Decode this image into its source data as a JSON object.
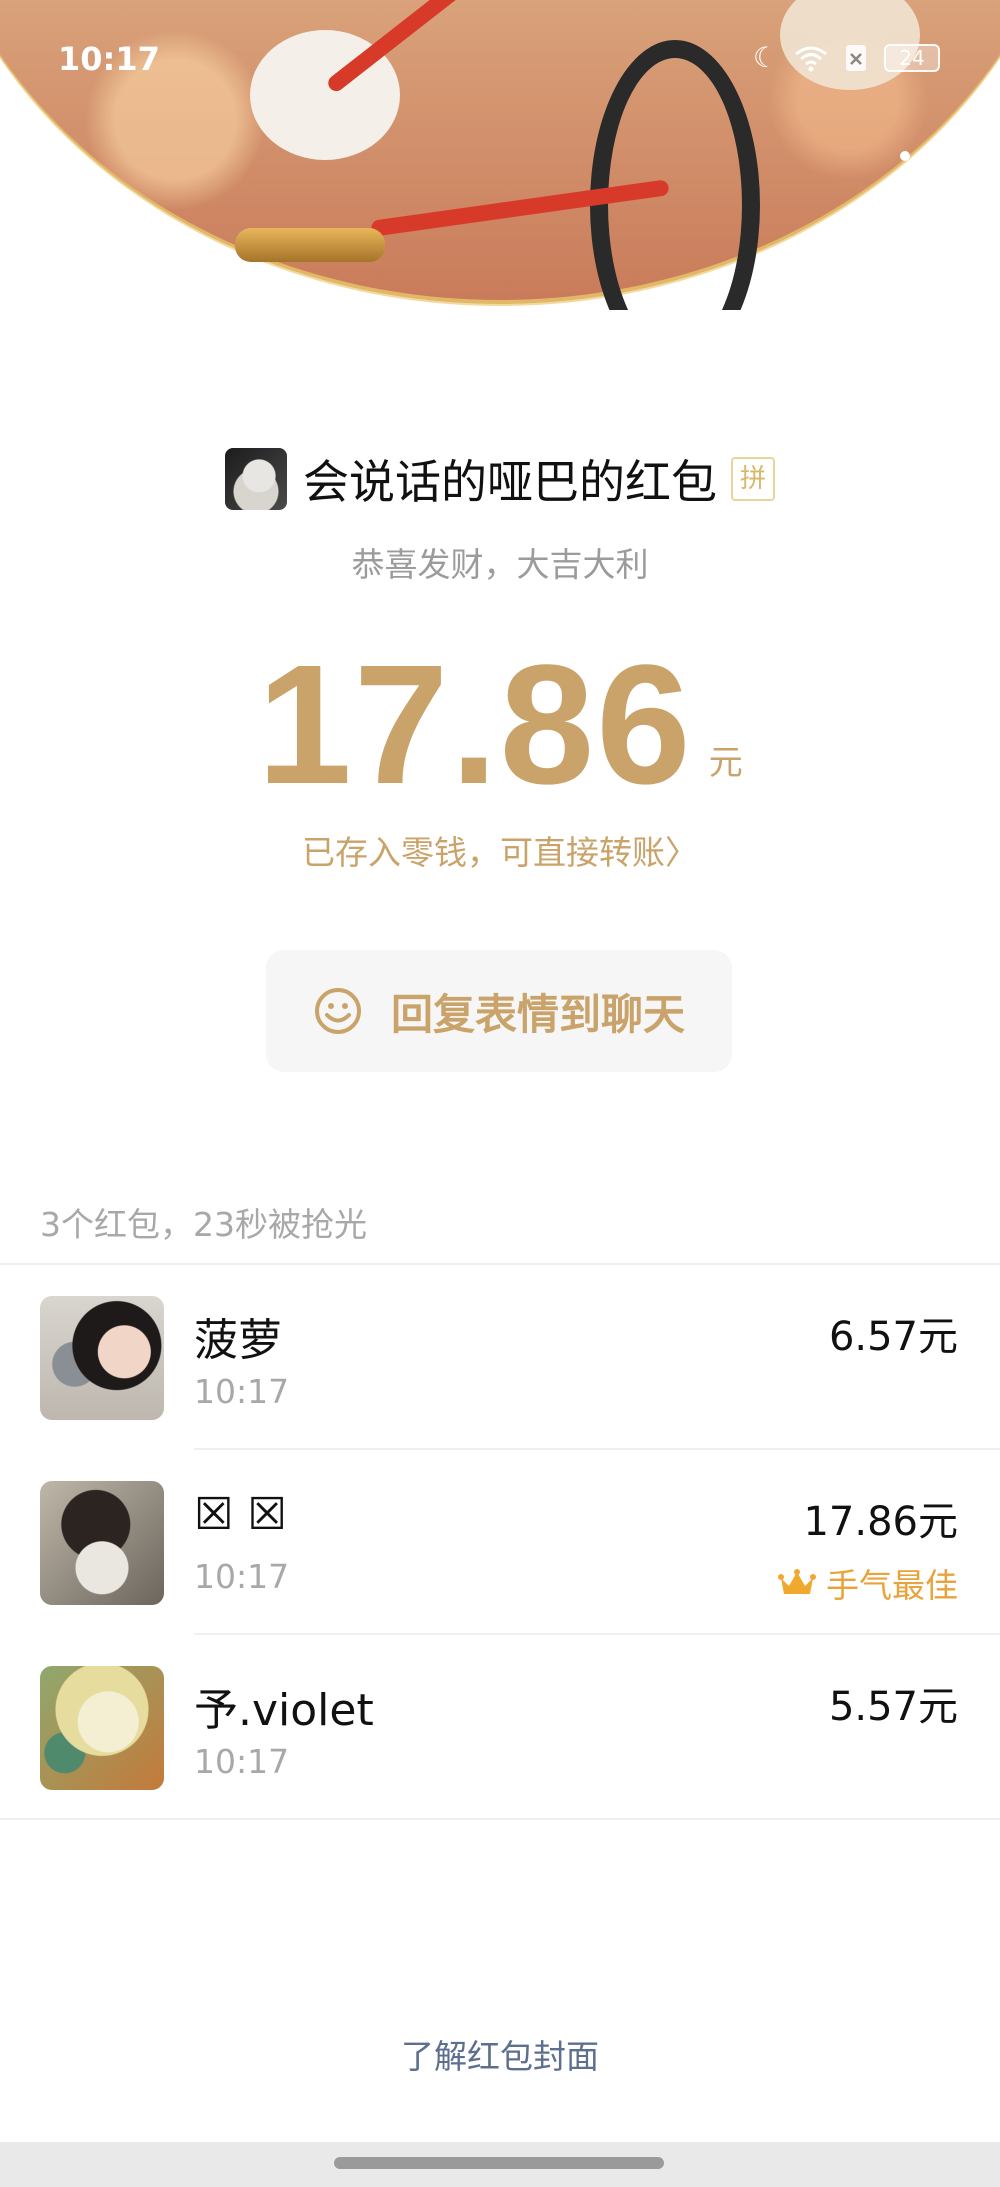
{
  "status_bar": {
    "time": "10:17",
    "battery": "24",
    "icons": [
      "moon-icon",
      "wifi-icon",
      "sim-off-icon",
      "battery-icon"
    ]
  },
  "header": {
    "back_icon": "chevron-left-icon",
    "more_icon": "more-dots-icon"
  },
  "packet": {
    "sender_name": "会说话的哑巴的红包",
    "badge": "拼",
    "greeting": "恭喜发财，大吉大利",
    "amount": "17.86",
    "unit": "元",
    "stored_note": "已存入零钱，可直接转账",
    "stored_arrow": "〉",
    "reply_label": "回复表情到聊天",
    "accent_color": "#c9a36a"
  },
  "claims": {
    "summary": "3个红包，23秒被抢光",
    "rows": [
      {
        "name": "菠萝",
        "time": "10:17",
        "amount": "6.57元",
        "best": ""
      },
      {
        "name": "☒ ☒",
        "time": "10:17",
        "amount": "17.86元",
        "best": "手气最佳"
      },
      {
        "name": "予.violet",
        "time": "10:17",
        "amount": "5.57元",
        "best": ""
      }
    ]
  },
  "footer": {
    "link": "了解红包封面"
  }
}
